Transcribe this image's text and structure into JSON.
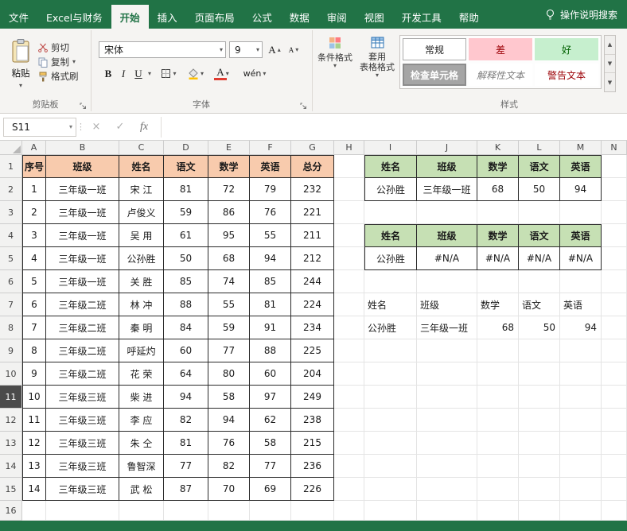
{
  "menu": {
    "tabs": [
      {
        "label": "文件",
        "active": false
      },
      {
        "label": "Excel与财务",
        "active": false
      },
      {
        "label": "开始",
        "active": true
      },
      {
        "label": "插入",
        "active": false
      },
      {
        "label": "页面布局",
        "active": false
      },
      {
        "label": "公式",
        "active": false
      },
      {
        "label": "数据",
        "active": false
      },
      {
        "label": "审阅",
        "active": false
      },
      {
        "label": "视图",
        "active": false
      },
      {
        "label": "开发工具",
        "active": false
      },
      {
        "label": "帮助",
        "active": false
      }
    ],
    "search_label": "操作说明搜索"
  },
  "ribbon": {
    "clipboard": {
      "paste": "粘贴",
      "cut": "剪切",
      "copy": "复制",
      "format_painter": "格式刷",
      "group_label": "剪贴板"
    },
    "font": {
      "font_name": "宋体",
      "font_size": "9",
      "bold": "B",
      "italic": "I",
      "underline": "U",
      "phonetic": "wén",
      "group_label": "字体"
    },
    "styles": {
      "conditional_formatting": "条件格式",
      "format_as_table_line1": "套用",
      "format_as_table_line2": "表格格式",
      "gallery": [
        {
          "label": "常规",
          "style": "normal"
        },
        {
          "label": "差",
          "style": "bad"
        },
        {
          "label": "好",
          "style": "good"
        },
        {
          "label": "检查单元格",
          "style": "check"
        },
        {
          "label": "解释性文本",
          "style": "explanatory"
        },
        {
          "label": "警告文本",
          "style": "warning"
        }
      ],
      "group_label": "样式"
    }
  },
  "formula_bar": {
    "name_box": "S11",
    "fx_label": "fx",
    "formula_value": ""
  },
  "grid": {
    "column_headers": [
      "A",
      "B",
      "C",
      "D",
      "E",
      "F",
      "G",
      "H",
      "I",
      "J",
      "K",
      "L",
      "M",
      "N"
    ],
    "row_count": 16,
    "selected_row": 11,
    "main_table": {
      "headers": [
        "序号",
        "班级",
        "姓名",
        "语文",
        "数学",
        "英语",
        "总分"
      ],
      "rows": [
        [
          "1",
          "三年级一班",
          "宋 江",
          "81",
          "72",
          "79",
          "232"
        ],
        [
          "2",
          "三年级一班",
          "卢俊义",
          "59",
          "86",
          "76",
          "221"
        ],
        [
          "3",
          "三年级一班",
          "吴 用",
          "61",
          "95",
          "55",
          "211"
        ],
        [
          "4",
          "三年级一班",
          "公孙胜",
          "50",
          "68",
          "94",
          "212"
        ],
        [
          "5",
          "三年级一班",
          "关 胜",
          "85",
          "74",
          "85",
          "244"
        ],
        [
          "6",
          "三年级二班",
          "林 冲",
          "88",
          "55",
          "81",
          "224"
        ],
        [
          "7",
          "三年级二班",
          "秦 明",
          "84",
          "59",
          "91",
          "234"
        ],
        [
          "8",
          "三年级二班",
          "呼延灼",
          "60",
          "77",
          "88",
          "225"
        ],
        [
          "9",
          "三年级二班",
          "花 荣",
          "64",
          "80",
          "60",
          "204"
        ],
        [
          "10",
          "三年级三班",
          "柴 进",
          "94",
          "58",
          "97",
          "249"
        ],
        [
          "11",
          "三年级三班",
          "李 应",
          "82",
          "94",
          "62",
          "238"
        ],
        [
          "12",
          "三年级三班",
          "朱 仝",
          "81",
          "76",
          "58",
          "215"
        ],
        [
          "13",
          "三年级三班",
          "鲁智深",
          "77",
          "82",
          "77",
          "236"
        ],
        [
          "14",
          "三年级三班",
          "武 松",
          "87",
          "70",
          "69",
          "226"
        ]
      ]
    },
    "lookup_table_1": {
      "headers": [
        "姓名",
        "班级",
        "数学",
        "语文",
        "英语"
      ],
      "row": [
        "公孙胜",
        "三年级一班",
        "68",
        "50",
        "94"
      ]
    },
    "lookup_table_2": {
      "headers": [
        "姓名",
        "班级",
        "数学",
        "语文",
        "英语"
      ],
      "row": [
        "公孙胜",
        "#N/A",
        "#N/A",
        "#N/A",
        "#N/A"
      ]
    },
    "plain_range": {
      "headers": [
        "姓名",
        "班级",
        "数学",
        "语文",
        "英语"
      ],
      "row": [
        "公孙胜",
        "三年级一班",
        "68",
        "50",
        "94"
      ]
    }
  },
  "colors": {
    "theme_green": "#217346",
    "table_header_orange": "#F8CBAD",
    "table_header_green": "#C6E0B4",
    "bad_bg": "#FFC7CE",
    "bad_text": "#9C0006",
    "good_bg": "#C6EFCE",
    "good_text": "#006100",
    "check_bg": "#A5A5A5",
    "warning_text": "#9C0006"
  }
}
